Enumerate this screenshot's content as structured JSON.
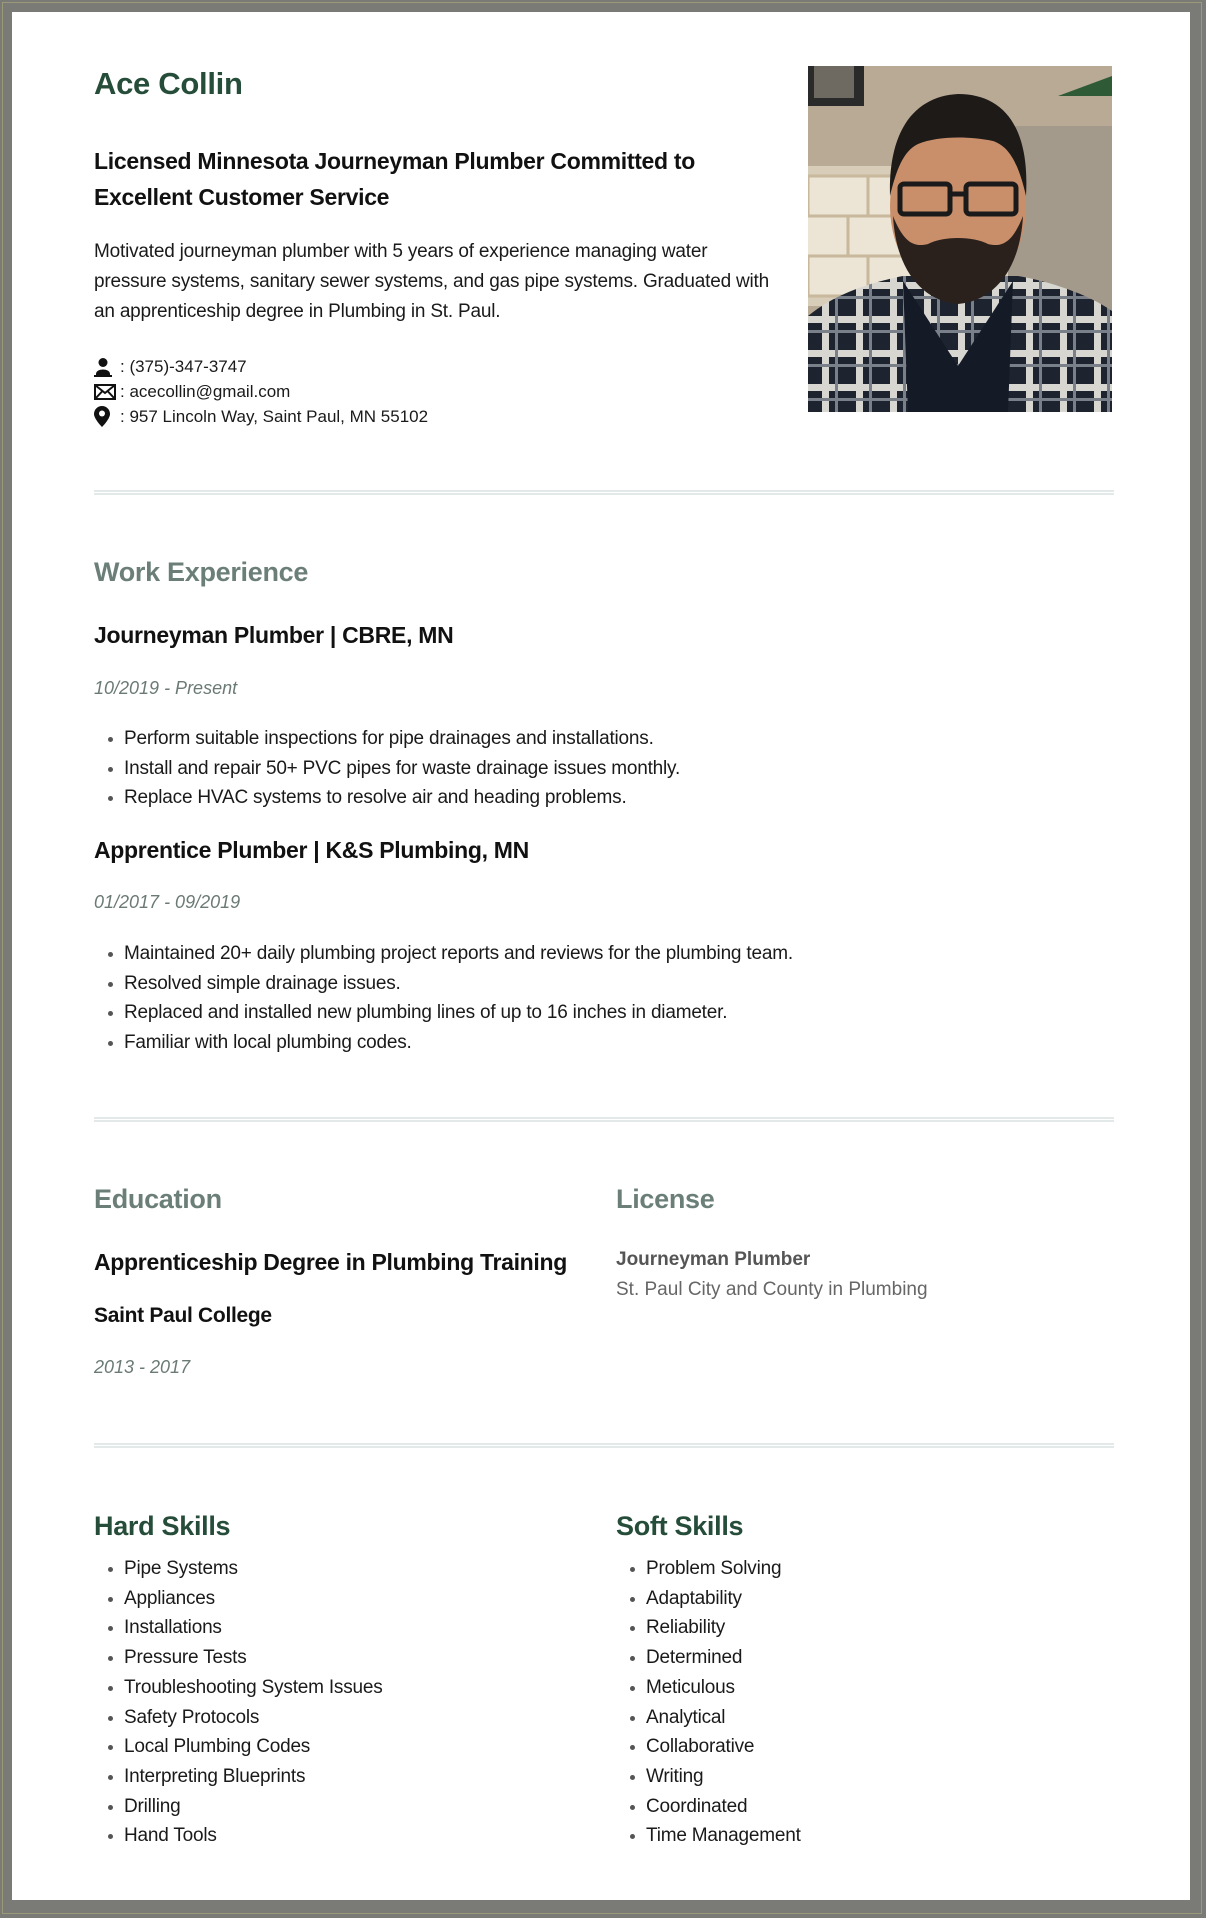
{
  "header": {
    "name": "Ace Collin",
    "headline": "Licensed Minnesota Journeyman Plumber Committed to Excellent Customer Service",
    "summary": "Motivated journeyman plumber with 5 years of experience managing water pressure systems, sanitary sewer systems, and gas pipe systems. Graduated with an apprenticeship degree in Plumbing in St. Paul.",
    "contacts": [
      {
        "icon": "person-icon",
        "text": ": (375)-347-3747"
      },
      {
        "icon": "envelope-icon",
        "text": ": acecollin@gmail.com"
      },
      {
        "icon": "location-pin-icon",
        "text": ": 957 Lincoln Way, Saint Paul, MN 55102"
      }
    ],
    "photo_alt": "Profile photo of Ace Collin"
  },
  "work": {
    "title": "Work Experience",
    "jobs": [
      {
        "title": "Journeyman Plumber | CBRE, MN",
        "dates": "10/2019 - Present",
        "bullets": [
          "Perform suitable inspections for pipe drainages and installations.",
          "Install and repair 50+ PVC pipes for waste drainage issues monthly.",
          "Replace HVAC systems to resolve air and heading problems."
        ]
      },
      {
        "title": "Apprentice Plumber | K&S Plumbing, MN",
        "dates": "01/2017 - 09/2019",
        "bullets": [
          "Maintained 20+ daily plumbing project reports and reviews for the plumbing team.",
          "Resolved simple drainage issues.",
          "Replaced and installed new plumbing lines of up to 16 inches in diameter.",
          "Familiar with local plumbing codes."
        ]
      }
    ]
  },
  "education": {
    "title": "Education",
    "degree": "Apprenticeship Degree in Plumbing Training",
    "school": "Saint Paul College",
    "dates": "2013 - 2017"
  },
  "license": {
    "title": "License",
    "name": "Journeyman Plumber",
    "issuer": "St. Paul City and County in Plumbing"
  },
  "hard_skills": {
    "title": "Hard Skills",
    "items": [
      "Pipe Systems",
      "Appliances",
      "Installations",
      "Pressure Tests",
      "Troubleshooting System Issues",
      "Safety Protocols",
      "Local Plumbing Codes",
      "Interpreting Blueprints",
      "Drilling",
      "Hand Tools"
    ]
  },
  "soft_skills": {
    "title": "Soft Skills",
    "items": [
      "Problem Solving",
      "Adaptability",
      "Reliability",
      "Determined",
      "Meticulous",
      "Analytical",
      "Collaborative",
      "Writing",
      "Coordinated",
      "Time Management"
    ]
  },
  "colors": {
    "name_green": "#264d3a",
    "section_gray_green": "#6b7f78",
    "date_gray": "#6b7a75",
    "divider": "#e3e9e8",
    "frame": "#7a7a76"
  }
}
